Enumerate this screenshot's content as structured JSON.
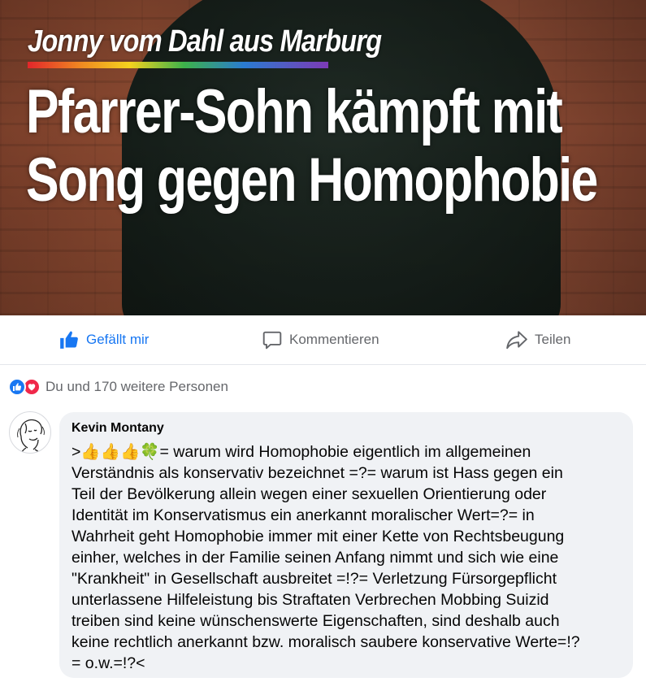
{
  "post_image": {
    "kicker": "Jonny vom Dahl aus Marburg",
    "headline_line1": "Pfarrer-Sohn kämpft mit",
    "headline_line2": "Song gegen Homophobie"
  },
  "actions": {
    "like_label": "Gefällt mir",
    "comment_label": "Kommentieren",
    "share_label": "Teilen"
  },
  "reactions": {
    "icons": [
      "like-icon",
      "love-icon"
    ],
    "summary": "Du und 170 weitere Personen"
  },
  "comment": {
    "author": "Kevin Montany",
    "text": ">👍👍👍🍀= warum wird Homophobie eigentlich im allgemeinen\nVerständnis als konservativ bezeichnet =?= warum ist Hass gegen ein\nTeil der Bevölkerung allein wegen einer sexuellen Orientierung oder\nIdentität im Konservatismus ein anerkannt moralischer Wert=?= in\nWahrheit geht Homophobie immer mit einer Kette von Rechtsbeugung\neinher, welches in der Familie seinen Anfang nimmt und sich wie eine\n\"Krankheit\" in Gesellschaft ausbreitet =!?= Verletzung Fürsorgepflicht\nunterlassene Hilfeleistung bis Straftaten Verbrechen Mobbing Suizid\ntreiben sind keine wünschenswerte Eigenschaften, sind deshalb auch\nkeine rechtlich anerkannt bzw. moralisch saubere konservative Werte=!?\n= o.w.=!?<"
  },
  "colors": {
    "accent": "#1877f2",
    "love": "#f0284a",
    "muted_text": "#65676b",
    "bubble_bg": "#f0f2f5"
  }
}
